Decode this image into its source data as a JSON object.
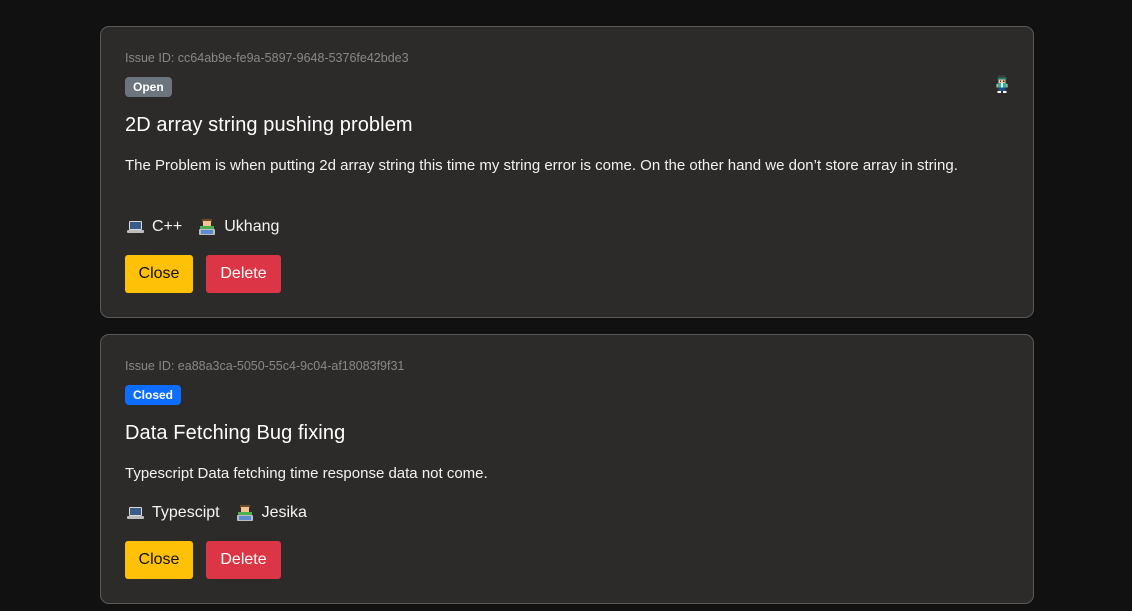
{
  "issues": [
    {
      "id_text": "Issue ID: cc64ab9e-fe9a-5897-9648-5376fe42bde3",
      "status": "Open",
      "title": "2D array string pushing problem",
      "description": "The Problem is when putting 2d array string this time my string error is come. On the other hand we don’t store array in string.",
      "language": "C++",
      "author": "Ukhang",
      "close_label": "Close",
      "delete_label": "Delete",
      "status_color": "#6c757d",
      "has_avatar": true
    },
    {
      "id_text": "Issue ID: ea88a3ca-5050-55c4-9c04-af18083f9f31",
      "status": "Closed",
      "title": "Data Fetching Bug fixing",
      "description": "Typescript Data fetching time response data not come.",
      "language": "Typescipt",
      "author": "Jesika",
      "close_label": "Close",
      "delete_label": "Delete",
      "status_color": "#0d6efd",
      "has_avatar": false
    }
  ],
  "icons": {
    "language": "laptop-icon",
    "author": "technologist-icon",
    "assignee": "pixel-avatar-icon"
  },
  "colors": {
    "background": "#121111",
    "card": "#2d2b2a",
    "close_button": "#ffc107",
    "delete_button": "#dc3545"
  }
}
